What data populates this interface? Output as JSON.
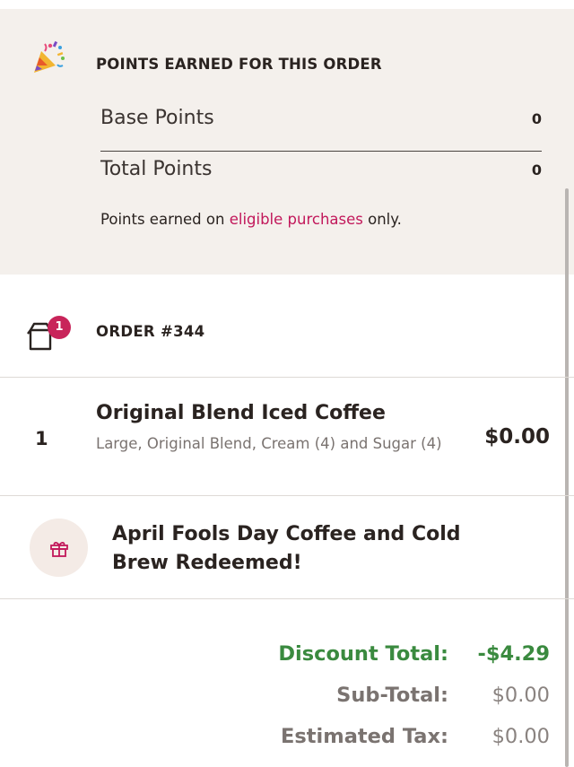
{
  "points": {
    "title": "POINTS EARNED FOR THIS ORDER",
    "base_label": "Base Points",
    "base_value": "0",
    "total_label": "Total Points",
    "total_value": "0",
    "note_prefix": "Points earned on ",
    "note_link": "eligible purchases",
    "note_suffix": " only."
  },
  "order": {
    "title": "ORDER #344",
    "item_count_badge": "1"
  },
  "items": [
    {
      "qty": "1",
      "name": "Original Blend Iced Coffee",
      "description": "Large, Original Blend, Cream (4) and Sugar (4)",
      "price": "$0.00"
    }
  ],
  "promo": {
    "text": "April Fools Day Coffee and Cold Brew Redeemed!"
  },
  "totals": {
    "discount_label": "Discount Total:",
    "discount_value": "-$4.29",
    "subtotal_label": "Sub-Total:",
    "subtotal_value": "$0.00",
    "tax_label": "Estimated Tax:",
    "tax_value": "$0.00"
  },
  "colors": {
    "accent_pink": "#c2185b",
    "badge": "#c8245a",
    "discount_green": "#3a8a3f",
    "panel_bg": "#f4f0ec"
  }
}
